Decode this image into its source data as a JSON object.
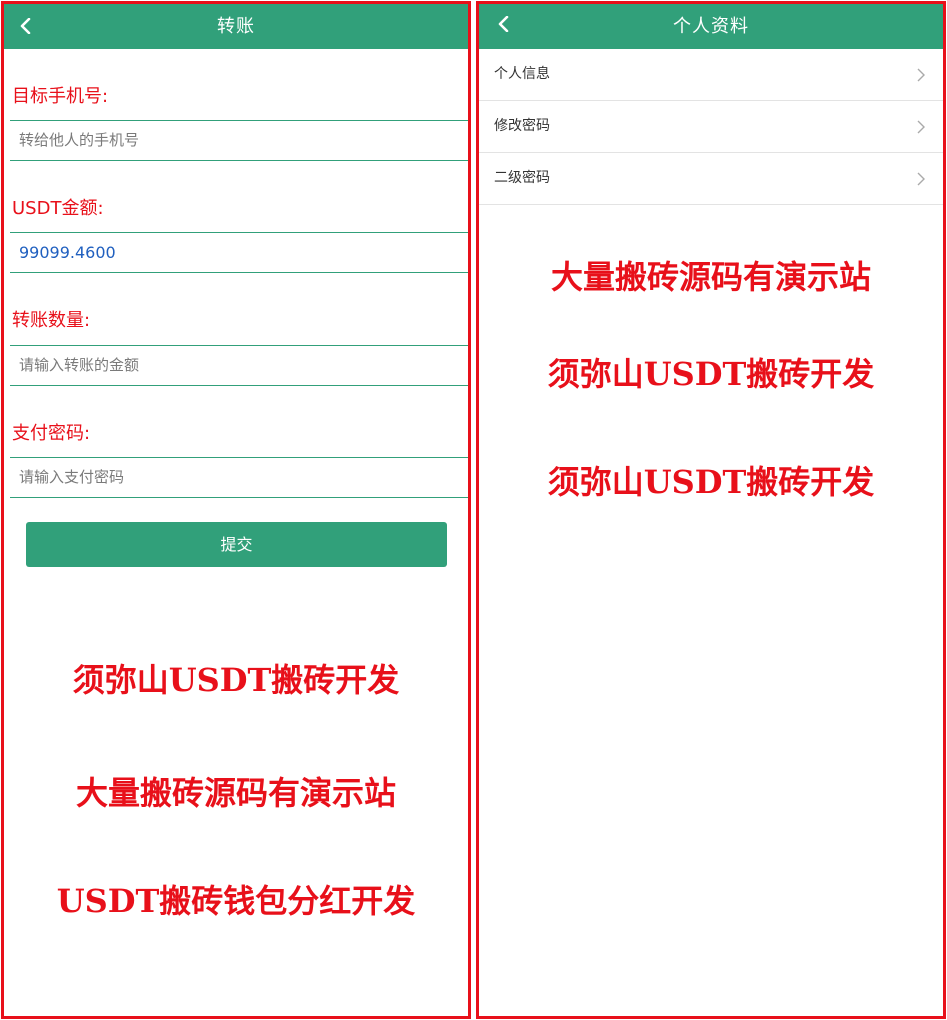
{
  "transfer_page": {
    "title": "转账",
    "fields": [
      {
        "label": "目标手机号:",
        "placeholder": "转给他人的手机号",
        "value": ""
      },
      {
        "label": "USDT金额:",
        "placeholder": "",
        "value": "99099.4600"
      },
      {
        "label": "转账数量:",
        "placeholder": "请输入转账的金额",
        "value": ""
      },
      {
        "label": "支付密码:",
        "placeholder": "请输入支付密码",
        "value": ""
      }
    ],
    "submit_label": "提交",
    "promo_lines": [
      "须弥山USDT搬砖开发",
      "大量搬砖源码有演示站",
      "USDT搬砖钱包分红开发"
    ]
  },
  "profile_page": {
    "title": "个人资料",
    "menu_items": [
      {
        "label": "个人信息"
      },
      {
        "label": "修改密码"
      },
      {
        "label": "二级密码"
      }
    ],
    "promo_lines": [
      "大量搬砖源码有演示站",
      "须弥山USDT搬砖开发",
      "须弥山USDT搬砖开发"
    ]
  },
  "colors": {
    "header_green": "#31a07a",
    "promo_red": "#e8101a",
    "value_blue": "#1f5fbf"
  },
  "icons": {
    "back": "chevron-left-icon",
    "menu_arrow": "chevron-right-icon"
  }
}
